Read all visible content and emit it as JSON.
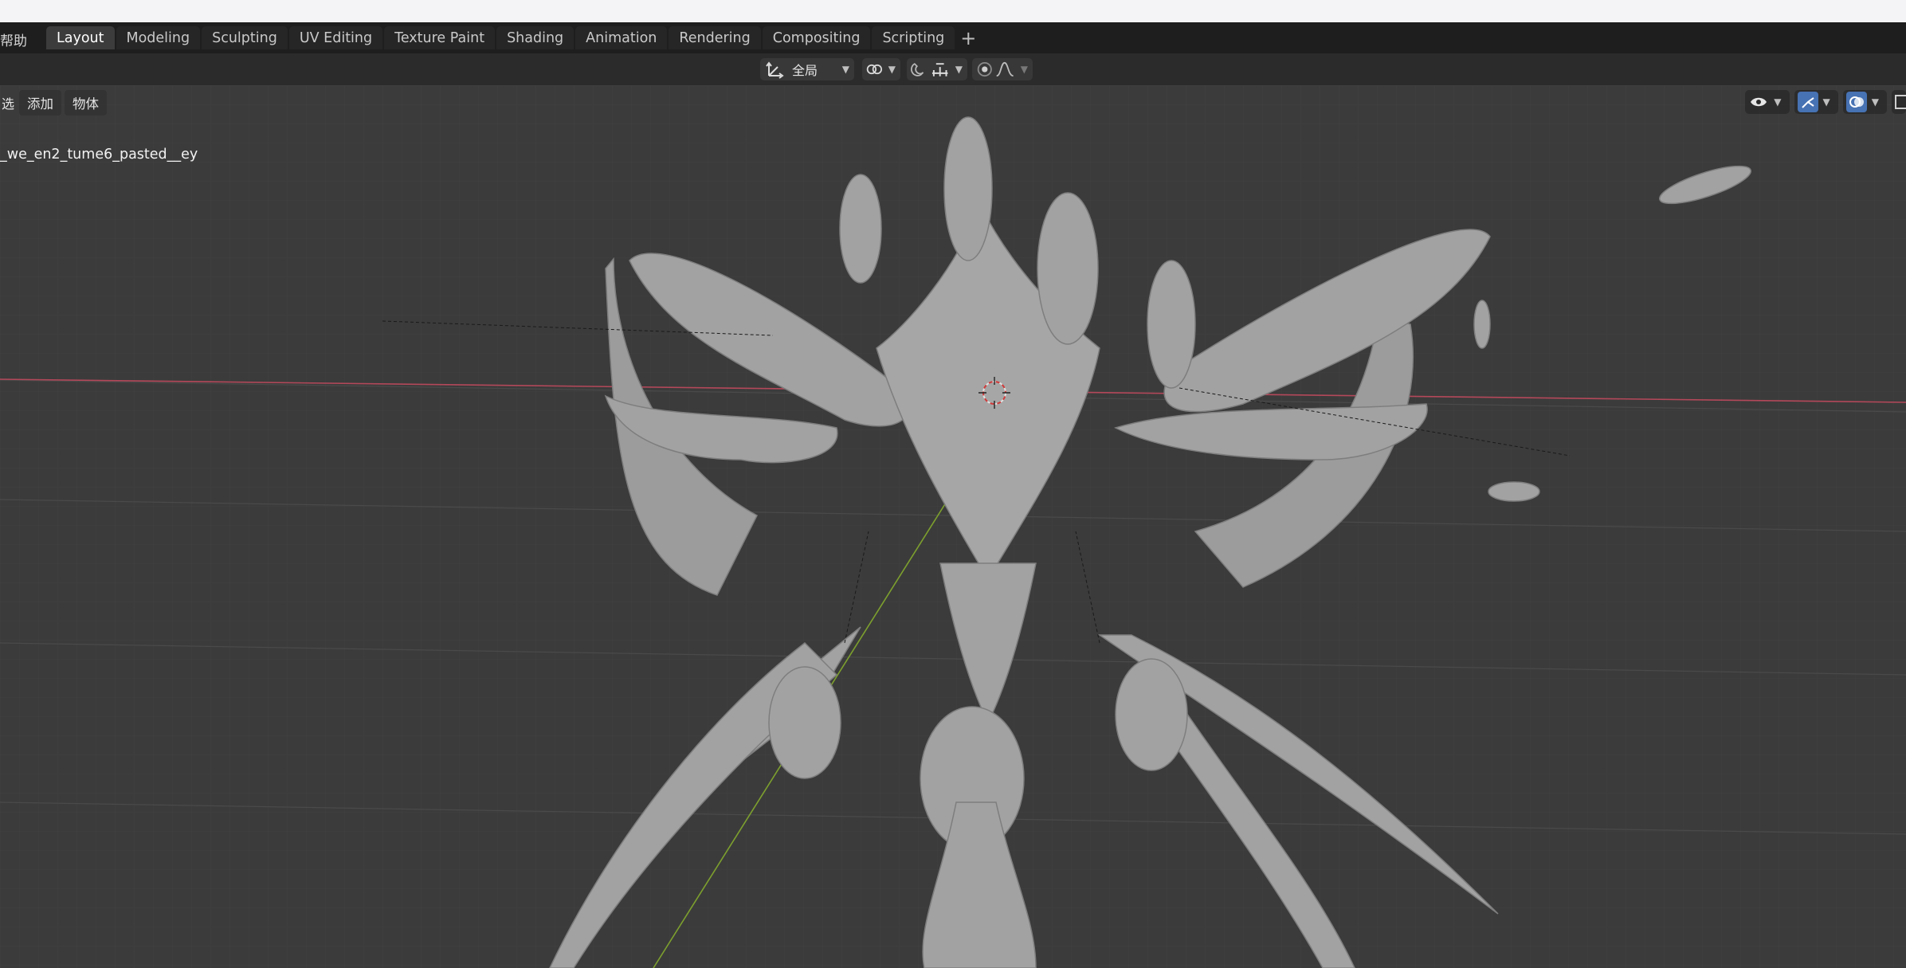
{
  "topbar": {
    "menu_fragment": "帮助",
    "workspace_tabs": [
      {
        "label": "Layout",
        "active": true
      },
      {
        "label": "Modeling"
      },
      {
        "label": "Sculpting"
      },
      {
        "label": "UV Editing"
      },
      {
        "label": "Texture Paint"
      },
      {
        "label": "Shading"
      },
      {
        "label": "Animation"
      },
      {
        "label": "Rendering"
      },
      {
        "label": "Compositing"
      },
      {
        "label": "Scripting"
      }
    ],
    "add_tab_icon": "plus-icon"
  },
  "toolbar": {
    "transform_orientation": "全局",
    "transform_icon": "transform-orientation-icon",
    "pivot_icon": "pivot-link-icon",
    "snap_icon": "magnet-snap-icon",
    "snap_target_icon": "snap-increment-icon",
    "proportional_icon": "proportional-edit-icon",
    "falloff_icon": "falloff-curve-icon"
  },
  "viewport": {
    "menu_fragment": "选",
    "menus": [
      "添加",
      "物体"
    ],
    "active_object": "_we_en2_tume6_pasted__ey",
    "overlay_tools": [
      {
        "icon": "eye-visibility-icon"
      },
      {
        "icon": "gizmo-icon",
        "active": true
      },
      {
        "icon": "overlays-icon",
        "active": true
      },
      {
        "icon": "xray-icon"
      }
    ],
    "colors": {
      "grid_bg": "#3d3d3d",
      "x_axis": "#b4485a",
      "y_axis": "#7da02e",
      "mesh": "#a2a2a2",
      "accent": "#4772b3"
    }
  }
}
